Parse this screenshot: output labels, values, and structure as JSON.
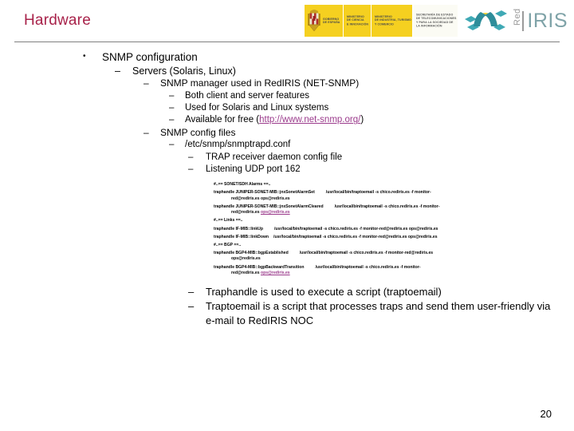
{
  "slide": {
    "title": "Hardware",
    "page_number": "20",
    "title_color": "#A8224A"
  },
  "header": {
    "logos": [
      {
        "id": "gobierno-de-espana",
        "text": "GOBIERNO\nDE ESPAÑA",
        "has_crest": true
      },
      {
        "id": "ministerio-ciencia-innovacion",
        "text": "MINISTERIO\nDE CIENCIA\nE INNOVACIÓN",
        "has_crest": false
      },
      {
        "id": "ministerio-industria-turismo-comercio",
        "text": "MINISTERIO\nDE INDUSTRIA, TURISMO\nY COMERCIO",
        "has_crest": false
      },
      {
        "id": "secretaria-estado-telecomunicaciones",
        "text": "SECRETARÍA DE ESTADO\nDE TELECOMUNICACIONES\nY PARA LA SOCIEDAD DE\nLA INFORMACIÓN",
        "has_crest": false
      }
    ],
    "rediris": {
      "red": "Red",
      "iris": "IRIS"
    }
  },
  "outline": {
    "l1_snmp_configuration": "SNMP configuration",
    "l2_servers": "Servers (Solaris, Linux)",
    "l3_snmp_manager": "SNMP manager used in RedIRIS (NET-SNMP)",
    "l4_both_client_server": "Both client and server features",
    "l4_used_for": "Used for Solaris and Linux systems",
    "l4_available_prefix": "Available for free (",
    "l4_available_link": "http://www.net-snmp.org/",
    "l4_available_suffix": ")",
    "l3_config_files": "SNMP config files",
    "l4_snmptrapd_path": "/etc/snmp/snmptrapd.conf",
    "l5_trap_receiver": "TRAP receiver daemon config file",
    "l5_listening_udp": "Listening UDP port 162",
    "l5_traphandle_desc": "Traphandle is used to execute a script (traptoemail)",
    "l5_traptoemail_desc": "Traptoemail is a script that processes traps and send them user-friendly via e-mail to RedIRIS NOC"
  },
  "config_file": {
    "comment_sonet": "#..== SONET/SDH Alarms ==..",
    "comment_links": "#..== Links ==..",
    "comment_bgp": "#..== BGP ==..",
    "line_sonet_set_a": "traphandle JUNIPER-SONET-MIB::jnxSonetAlarmSet",
    "line_sonet_set_b": "/usr/local/bin/traptoemail -s chico.rediris.es -f monitor-",
    "line_sonet_set_c": "red@rediris.es ops@rediris.es",
    "line_sonet_clear_a": "traphandle JUNIPER-SONET-MIB::jnxSonetAlarmCleared",
    "line_sonet_clear_b": "/usr/local/bin/traptoemail -s chico.rediris.es -f monitor-",
    "line_sonet_clear_c": "red@rediris.es ",
    "line_sonet_clear_link": "ops@rediris.es",
    "line_linkup_a": "traphandle IF-MIB::linkUp",
    "line_linkup_b": "/usr/local/bin/traptoemail -s chico.rediris.es -f monitor-red@rediris.es ops@rediris.es",
    "line_linkdown_a": "traphandle IF-MIB::linkDown",
    "line_linkdown_b": "/usr/local/bin/traptoemail -s chico.rediris.es -f monitor-red@rediris.es ops@rediris.es",
    "line_bgpest_a": "traphandle BGP4-MIB::bgpEstablished",
    "line_bgpest_b": "/usr/local/bin/traptoemail -s chico.rediris.es -f monitor-red@rediris.es",
    "line_bgpest_c": "ops@rediris.es",
    "line_bgpbwd_a": "traphandle BGP4-MIB::bgpBackwardTransition",
    "line_bgpbwd_b": "/usr/local/bin/traptoemail -s chico.rediris.es -f monitor-",
    "line_bgpbwd_c": "red@rediris.es ",
    "line_bgpbwd_link": "ops@rediris.es"
  },
  "marks": {
    "disc": "•",
    "dash": "–"
  }
}
